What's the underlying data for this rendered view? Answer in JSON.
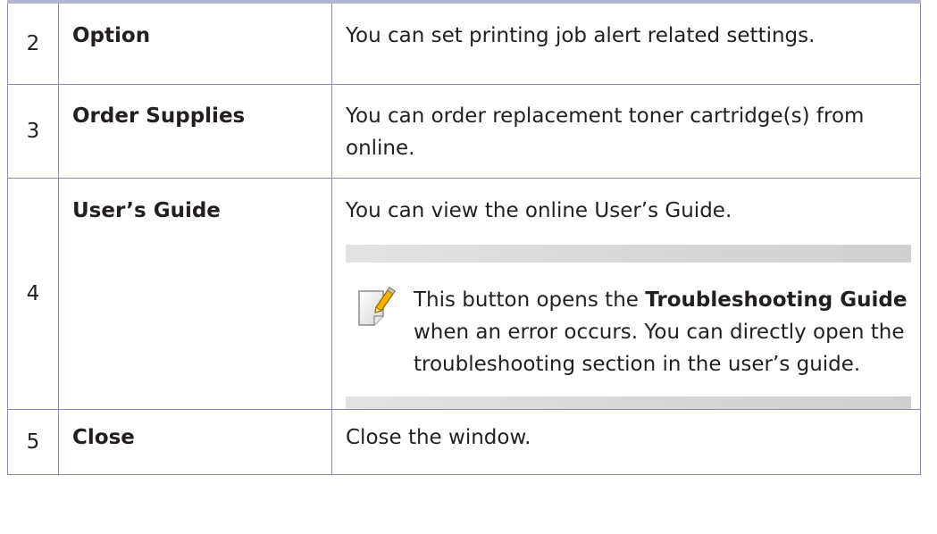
{
  "rows": [
    {
      "num": "2",
      "name": "Option",
      "desc": "You can set printing job alert related settings."
    },
    {
      "num": "3",
      "name": "Order Supplies",
      "desc": "You can order replacement toner cartridge(s) from online."
    },
    {
      "num": "4",
      "name": "User’s Guide",
      "desc": "You can view the online User’s Guide."
    },
    {
      "num": "5",
      "name": "Close",
      "desc": "Close the window."
    }
  ],
  "note": {
    "icon": "note-pencil-icon",
    "text_1": "This button opens the ",
    "bold_1": "Troubleshooting Guide",
    "text_2": " when an error occurs. You can directly open the troubleshooting section in the user’s guide."
  },
  "colors": {
    "rule": "#b3b3d4",
    "border": "#8a8ab8",
    "note_bar": "#d9d9d9"
  }
}
